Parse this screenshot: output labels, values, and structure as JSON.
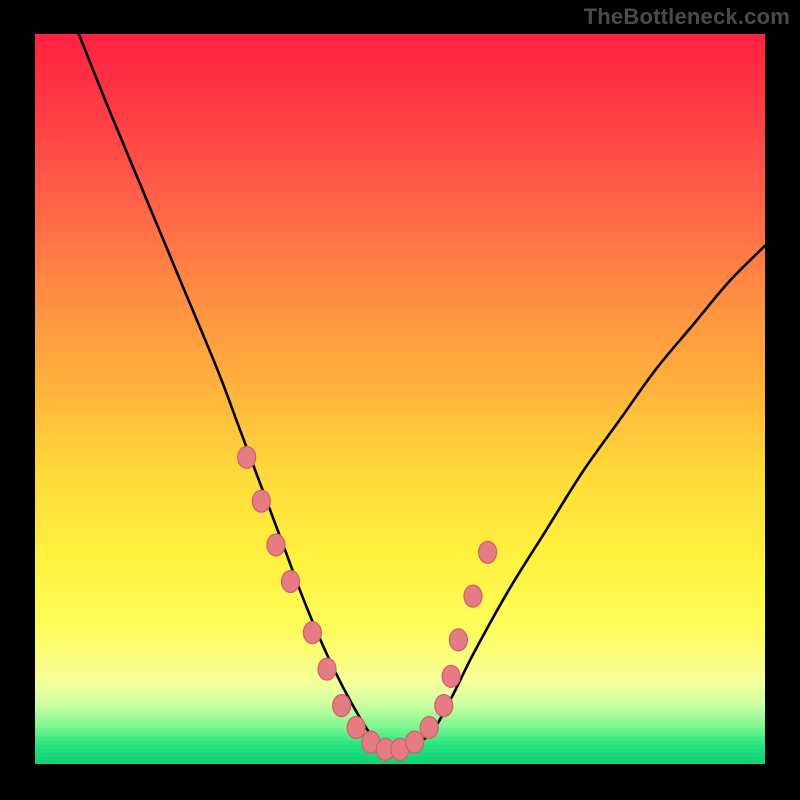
{
  "watermark": "TheBottleneck.com",
  "chart_data": {
    "type": "line",
    "title": "",
    "xlabel": "",
    "ylabel": "",
    "xlim": [
      0,
      100
    ],
    "ylim": [
      0,
      100
    ],
    "series": [
      {
        "name": "bottleneck-curve",
        "x": [
          6,
          10,
          15,
          20,
          25,
          28,
          31,
          34,
          37,
          40,
          43,
          46,
          48,
          50,
          54,
          57,
          60,
          65,
          70,
          75,
          80,
          85,
          90,
          95,
          100
        ],
        "values": [
          100,
          90,
          78,
          66,
          54,
          46,
          38,
          30,
          22,
          15,
          9,
          4,
          2,
          2,
          4,
          9,
          15,
          24,
          32,
          40,
          47,
          54,
          60,
          66,
          71
        ]
      }
    ],
    "markers": {
      "name": "sample-points",
      "x": [
        29,
        31,
        33,
        35,
        38,
        40,
        42,
        44,
        46,
        48,
        50,
        52,
        54,
        56,
        57,
        58,
        60,
        62
      ],
      "values": [
        42,
        36,
        30,
        25,
        18,
        13,
        8,
        5,
        3,
        2,
        2,
        3,
        5,
        8,
        12,
        17,
        23,
        29
      ]
    },
    "background": {
      "type": "vertical-gradient",
      "stops": [
        {
          "pos": 0.0,
          "color": "#ff213f"
        },
        {
          "pos": 0.5,
          "color": "#ffc33b"
        },
        {
          "pos": 0.82,
          "color": "#fdfd5d"
        },
        {
          "pos": 0.95,
          "color": "#78f58e"
        },
        {
          "pos": 1.0,
          "color": "#0fd077"
        }
      ]
    }
  }
}
